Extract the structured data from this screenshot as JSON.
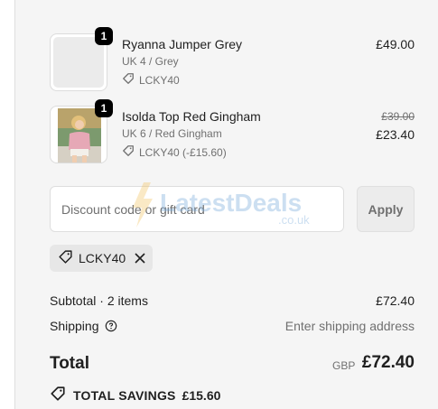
{
  "colors": {
    "panel_bg": "#f5f5f5",
    "text": "#1f1f1f",
    "muted": "#707070",
    "badge": "#000000"
  },
  "items": [
    {
      "qty": "1",
      "name": "Ryanna Jumper Grey",
      "variant": "UK 4 / Grey",
      "code": "LCKY40",
      "price": "£49.00",
      "icon": "tag-icon"
    },
    {
      "qty": "1",
      "name": "Isolda Top Red Gingham",
      "variant": "UK 6 / Red Gingham",
      "code": "LCKY40 (-£15.60)",
      "original_price": "£39.00",
      "price": "£23.40",
      "icon": "tag-icon"
    }
  ],
  "discount": {
    "placeholder": "Discount code or gift card",
    "apply_label": "Apply"
  },
  "watermark": {
    "brand": "LatestDeals",
    "domain": ".co.uk"
  },
  "applied_code": {
    "label": "LCKY40",
    "icon": "tag-icon",
    "remove_icon": "close-icon"
  },
  "summary": {
    "subtotal_label": "Subtotal · 2 items",
    "subtotal_value": "£72.40",
    "shipping_label": "Shipping",
    "shipping_value": "Enter shipping address",
    "total_label": "Total",
    "currency": "GBP",
    "total_value": "£72.40",
    "savings_label": "TOTAL SAVINGS",
    "savings_value": "£15.60"
  }
}
